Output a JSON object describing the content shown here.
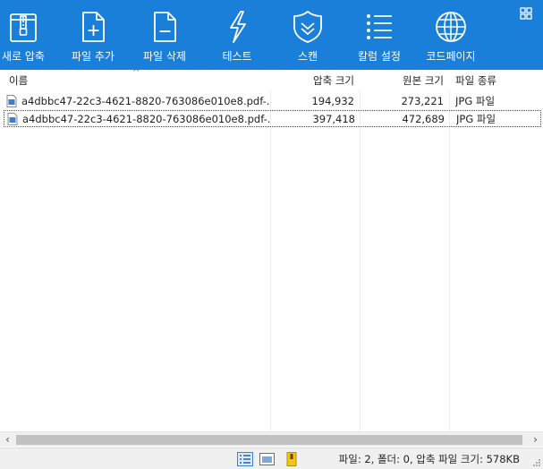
{
  "toolbar": {
    "buttons": [
      {
        "label": "새로 압축",
        "icon": "zip-archive-icon"
      },
      {
        "label": "파일 추가",
        "icon": "file-add-icon"
      },
      {
        "label": "파일 삭제",
        "icon": "file-delete-icon"
      },
      {
        "label": "테스트",
        "icon": "lightning-icon"
      },
      {
        "label": "스캔",
        "icon": "shield-icon"
      },
      {
        "label": "칼럼 설정",
        "icon": "column-settings-icon"
      },
      {
        "label": "코드페이지",
        "icon": "globe-icon"
      }
    ],
    "menu_icon": "grid-menu-icon"
  },
  "columns": {
    "name": "이름",
    "packed": "압축 크기",
    "original": "원본 크기",
    "type": "파일 종류"
  },
  "sort_indicator": "^",
  "files": [
    {
      "name": "a4dbbc47-22c3-4621-8820-763086e010e8.pdf-...",
      "packed": "194,932",
      "original": "273,221",
      "type": "JPG 파일",
      "selected": false
    },
    {
      "name": "a4dbbc47-22c3-4621-8820-763086e010e8.pdf-...",
      "packed": "397,418",
      "original": "472,689",
      "type": "JPG 파일",
      "selected": true
    }
  ],
  "statusbar": {
    "text": "파일: 2, 폴더: 0, 압축 파일 크기: 578KB",
    "view_icons": [
      "details-view-icon",
      "preview-view-icon",
      "archive-info-icon"
    ]
  },
  "colors": {
    "toolbar_bg": "#1a7fd8",
    "toolbar_icon": "#ffffff",
    "status_bg": "#f0f0f0"
  }
}
